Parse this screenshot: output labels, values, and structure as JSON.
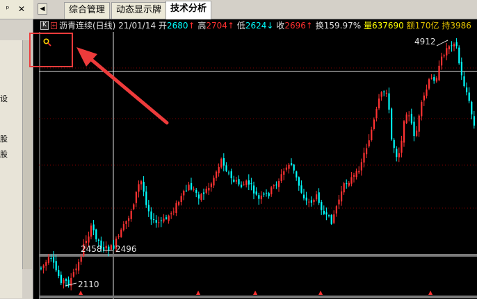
{
  "side_panel": {
    "pin_icon": "pin-icon",
    "close_icon": "close-icon",
    "chars": [
      "设",
      "股",
      "股"
    ]
  },
  "tabs": [
    {
      "label": "综合管理",
      "active": false
    },
    {
      "label": "动态显示牌",
      "active": false
    },
    {
      "label": "技术分析",
      "active": true
    }
  ],
  "header": {
    "k_badge": "K",
    "plus_badge": "+",
    "stock_name": "沥青连续(日线)",
    "date": "21/01/14",
    "open_label": "开",
    "open_value": "2680",
    "high_label": "高",
    "high_value": "2704",
    "low_label": "低",
    "low_value": "2624",
    "close_label": "收",
    "close_value": "2696",
    "turnover_label": "换",
    "turnover_value": "159.97%",
    "volume_label": "量",
    "volume_value": "637690",
    "amount_label": "额",
    "amount_value": "170亿",
    "position_label": "持",
    "position_value": "3986"
  },
  "chart_data": {
    "type": "candlestick",
    "price_labels": {
      "peak": "4912",
      "low": "2110",
      "left_level": "2458",
      "right_level": "2496"
    },
    "colors": {
      "up": "#ff3232",
      "down": "#00ffff",
      "background": "#000000",
      "grid": "#800000"
    }
  }
}
